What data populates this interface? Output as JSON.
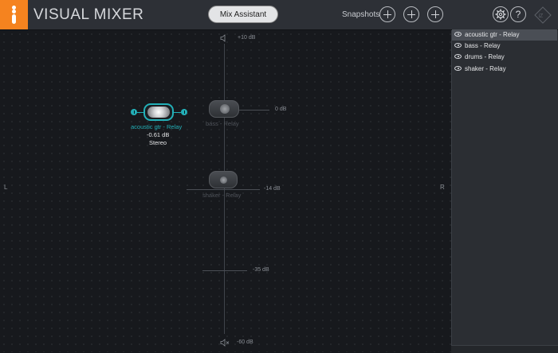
{
  "app": {
    "title": "VISUAL MIXER"
  },
  "toolbar": {
    "mix_assistant_label": "Mix Assistant",
    "snapshots_label": "Snapshots",
    "help_label": "?",
    "settings_icon": "gear-icon",
    "accent_color": "#f5831f"
  },
  "stage": {
    "db_top": "+10 dB",
    "db_bottom": "-60 dB",
    "left_label": "L",
    "right_label": "R",
    "markers": [
      {
        "label": "0 dB"
      },
      {
        "label": "-14 dB"
      },
      {
        "label": "-35 dB"
      }
    ]
  },
  "tracks": {
    "acoustic": {
      "name": "acoustic gtr - Relay",
      "gain": "-0.61 dB",
      "mode": "Stereo",
      "color": "#23b0b8"
    },
    "bass": {
      "name": "bass - Relay"
    },
    "shaker": {
      "name": "shaker - Relay"
    }
  },
  "sidebar": {
    "items": [
      {
        "label": "acoustic gtr - Relay",
        "selected": true,
        "visible": true
      },
      {
        "label": "bass - Relay",
        "selected": false,
        "visible": true
      },
      {
        "label": "drums - Relay",
        "selected": false,
        "visible": true
      },
      {
        "label": "shaker - Relay",
        "selected": false,
        "visible": true
      }
    ]
  }
}
